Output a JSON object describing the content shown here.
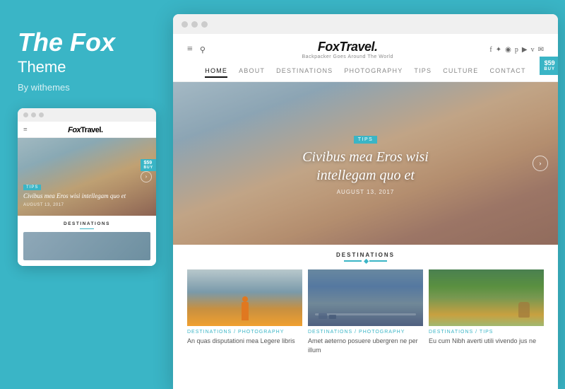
{
  "left": {
    "title": "The Fox",
    "subtitle": "Theme",
    "author": "By withemes"
  },
  "mini_preview": {
    "logo": "FoxTravel.",
    "tips_badge": "TIPS",
    "hero_title": "Civibus mea Eros wisi intellegam quo et",
    "hero_date": "AUGUST 13, 2017",
    "destinations_label": "DESTINATIONS",
    "buy_label": "$59",
    "buy_sub": "BUY"
  },
  "site": {
    "logo_name": "FoxTravel.",
    "logo_tagline": "Backpacker Goes Around The World",
    "nav_items": [
      "HOME",
      "ABOUT",
      "DESTINATIONS",
      "PHOTOGRAPHY",
      "TIPS",
      "CULTURE",
      "CONTACT"
    ],
    "hero": {
      "badge": "TIPS",
      "title": "Civibus mea Eros wisi intellegam quo et",
      "date": "AUGUST 13, 2017"
    },
    "buy_badge": "$59",
    "buy_sub": "BUY",
    "destinations": {
      "heading": "DESTINATIONS",
      "cards": [
        {
          "category": "DESTINATIONS / PHOTOGRAPHY",
          "text": "An quas disputationi mea Legere libris"
        },
        {
          "category": "DESTINATIONS / PHOTOGRAPHY",
          "text": "Amet aeterno posuere ubergren ne per illum"
        },
        {
          "category": "DESTINATIONS / TIPS",
          "text": "Eu cum Nibh averti utili vivendo jus ne"
        }
      ]
    }
  },
  "browser_dots": [
    "dot1",
    "dot2",
    "dot3"
  ],
  "icons": {
    "hamburger": "≡",
    "search": "🔍",
    "arrow_right": "›",
    "social_f": "f",
    "social_t": "✦",
    "social_i": "◉",
    "social_p": "p",
    "social_y": "▶",
    "social_v": "v",
    "social_e": "✉"
  }
}
